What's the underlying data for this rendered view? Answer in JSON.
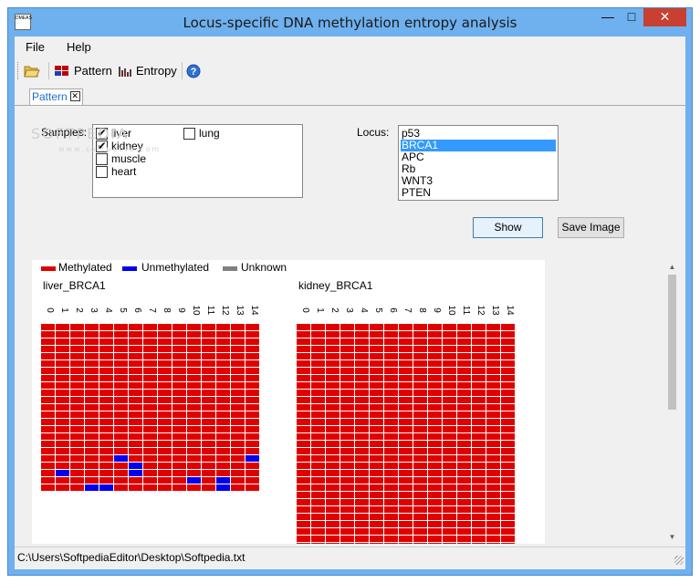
{
  "window": {
    "title": "Locus-specific DNA methylation entropy analysis",
    "icon_text": "DMEAS"
  },
  "menu": [
    "File",
    "Help"
  ],
  "toolbar": {
    "open_icon": "folder-open-icon",
    "pattern_label": "Pattern",
    "entropy_label": "Entropy",
    "help_icon": "help-icon"
  },
  "tabs": [
    {
      "label": "Pattern"
    }
  ],
  "samples": {
    "label": "Samples:",
    "items": [
      {
        "name": "liver",
        "checked": true
      },
      {
        "name": "kidney",
        "checked": true
      },
      {
        "name": "muscle",
        "checked": false
      },
      {
        "name": "heart",
        "checked": false
      },
      {
        "name": "lung",
        "checked": false
      }
    ],
    "watermark": "SOFTPEDIA"
  },
  "locus": {
    "label": "Locus:",
    "items": [
      "p53",
      "BRCA1",
      "APC",
      "Rb",
      "WNT3",
      "PTEN"
    ],
    "selected": "BRCA1"
  },
  "buttons": {
    "show": "Show",
    "save_image": "Save Image"
  },
  "legend": [
    {
      "label": "Methylated",
      "color": "#e00000"
    },
    {
      "label": "Unmethylated",
      "color": "#0000ee"
    },
    {
      "label": "Unknown",
      "color": "#808080"
    }
  ],
  "plots": [
    {
      "title": "liver_BRCA1",
      "columns": [
        "0",
        "1",
        "2",
        "3",
        "4",
        "5",
        "6",
        "7",
        "8",
        "9",
        "10",
        "11",
        "12",
        "13",
        "14"
      ],
      "rows_visible": 23,
      "unmethylated_cells": [
        [
          18,
          5
        ],
        [
          18,
          14
        ],
        [
          19,
          6
        ],
        [
          20,
          1
        ],
        [
          20,
          6
        ],
        [
          21,
          10
        ],
        [
          21,
          12
        ],
        [
          22,
          3
        ],
        [
          22,
          4
        ],
        [
          22,
          12
        ],
        [
          23,
          2
        ],
        [
          23,
          3
        ],
        [
          23,
          5
        ],
        [
          23,
          10
        ],
        [
          23,
          11
        ],
        [
          23,
          12
        ],
        [
          23,
          14
        ]
      ]
    },
    {
      "title": "kidney_BRCA1",
      "columns": [
        "0",
        "1",
        "2",
        "3",
        "4",
        "5",
        "6",
        "7",
        "8",
        "9",
        "10",
        "11",
        "12",
        "13",
        "14"
      ],
      "rows_visible": 31,
      "unmethylated_cells": []
    }
  ],
  "status": {
    "path": "C:\\Users\\SoftpediaEditor\\Desktop\\Softpedia.txt"
  }
}
